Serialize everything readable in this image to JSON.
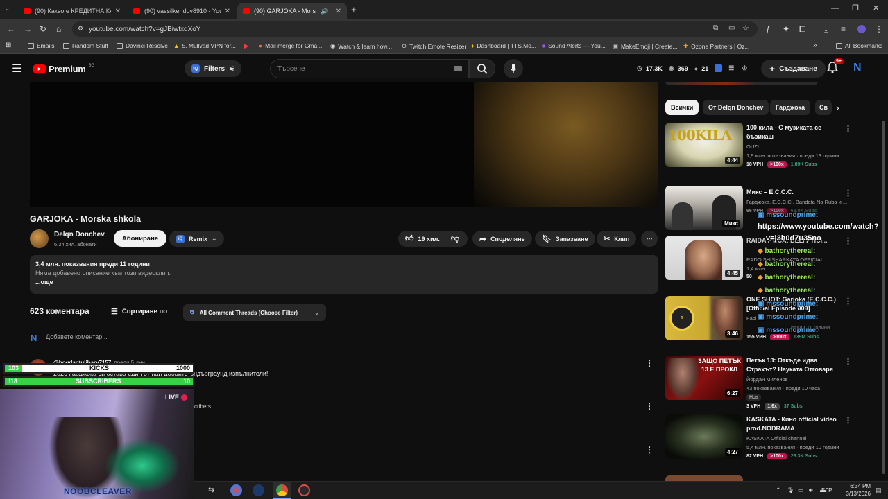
{
  "browser": {
    "tabs": [
      {
        "title": "(90) Какво е КРЕДИТНА КАРТА?"
      },
      {
        "title": "(90) vassilkendov8910 - YouTube"
      },
      {
        "title": "(90) GARJOKA - Morska shkola"
      }
    ],
    "url": "youtube.com/watch?v=gJBiwtxqXoY",
    "bookmarks": [
      "Emails",
      "Random Stuff",
      "Davinci Resolve",
      "5. Mullvad VPN for...",
      "Mail merge for Gma...",
      "Watch & learn how...",
      "Twitch Emote Resizer",
      "Dashboard | TTS.Mo...",
      "Sound Alerts — You...",
      "MakeEmoji | Create...",
      "Ozone Partners | Oz...",
      "All Bookmarks"
    ]
  },
  "header": {
    "logo": "Premium",
    "region": "BG",
    "filters": "Filters",
    "search_placeholder": "Търсене",
    "stats": {
      "views": "17.3K",
      "watch": "369",
      "count": "21"
    },
    "create": "Създаване",
    "notif": "9+",
    "avatar": "N"
  },
  "video": {
    "title": "GARJOKA - Morska shkola",
    "channel": "Delqn Donchev",
    "subs": "6,34 хил. абонати",
    "subscribe": "Абониране",
    "remix": "Remix",
    "likes": "19 хил.",
    "share": "Споделяне",
    "save": "Запазване",
    "clip": "Клип",
    "views_date": "3,4 млн. показвания  преди 11 години",
    "no_desc": "Няма добавено описание към този видеоклип.",
    "more": "...още"
  },
  "comments": {
    "count": "623 коментара",
    "sort": "Сортиране по",
    "filter": "All Comment Threads (Choose Filter)",
    "add_placeholder": "Добавете коментар...",
    "first_author": "@bogdantulibarv7157",
    "first_time": "преди 5 дни",
    "first_text": "2026 Гарджока си остава един от най-добрите ъндърграунд изпълнители!",
    "subscribers_fragment": "cribers"
  },
  "sidebar": {
    "chips": [
      "Всички",
      "От Delqn Donchev",
      "Гарджока",
      "Св"
    ],
    "videos": [
      {
        "title": "100 кила - С музиката се бъзикаш",
        "channel": "OUZI",
        "meta": "1,9 млн. показвания · преди 13 години",
        "vph": "18 VPH",
        "mult": ">100x",
        "subs": "1.89K Subs",
        "dur": "4:44"
      },
      {
        "title": "Микс – Е.С.С.С.",
        "channel": "Гарджока, Е.С.С.С., Bandata Na Ruba и ...",
        "meta": "",
        "vph": "96 VPH",
        "mult": ">100x",
        "subs": "68.8K Subs",
        "dur": "Микс"
      },
      {
        "title": "RAIDA PTICA: BELI PTICI...",
        "channel": "RADO SHISHARKATA OFFICIAL",
        "meta": "1,4 млн.",
        "vph": "50",
        "mult": "",
        "subs": "",
        "dur": "4:45"
      },
      {
        "title": "ONE SHOT: Garjoka (E.C.C.C.) [Official Episode 009]",
        "channel": "Faci",
        "meta": "преди 11 години",
        "vph": "155 VPH",
        "mult": ">100x",
        "subs": "139M Subs",
        "dur": "3:46"
      },
      {
        "title": "Петък 13: Откъде идва Страхът? Науката Отговаря",
        "channel": "Йордан Миленов",
        "meta": "43 показвания · преди 10 часа",
        "tag": "Нов",
        "vph": "3 VPH",
        "mult": "1.6x",
        "subs": "37 Subs",
        "dur": "6:27"
      },
      {
        "title": "KASKATA - Кино official video prod.NODRAMA",
        "channel": "KASKATA Official channel",
        "meta": "5,4 млн. показвания · преди 10 години",
        "vph": "82 VPH",
        "mult": ">100x",
        "subs": "26.3K Subs",
        "dur": "4:27"
      }
    ],
    "thumb5_text": "ЗАЩО ПЕТЪК 13 Е ПРОКЛ"
  },
  "overlay": {
    "chat": [
      {
        "user": "mssoundprime",
        "text": ":"
      },
      {
        "user": "",
        "text": "https://www.youtube.com/watch?"
      },
      {
        "user": "",
        "text": "v=j3h0d7u35no"
      },
      {
        "user": "bathorythereal",
        "text": ":"
      },
      {
        "user": "bathorythereal",
        "text": ":"
      },
      {
        "user": "bathorythereal",
        "text": ":"
      },
      {
        "user": "bathorythereal",
        "text": ":"
      },
      {
        "user": "mssoundprime",
        "text": ":"
      },
      {
        "user": "mssoundprime",
        "text": ":"
      },
      {
        "user": "mssoundprime",
        "text": ":"
      }
    ],
    "goals": [
      {
        "left": "103",
        "label": "KICKS",
        "right": "1000"
      },
      {
        "left": "!18",
        "label": "SUBSCRIBERS",
        "right": "10"
      }
    ],
    "live": "LIVE",
    "streamer": "NOOBCLEAVER"
  },
  "taskbar": {
    "lang": "БГР",
    "time": "6:34 PM",
    "date": "3/13/2026"
  }
}
